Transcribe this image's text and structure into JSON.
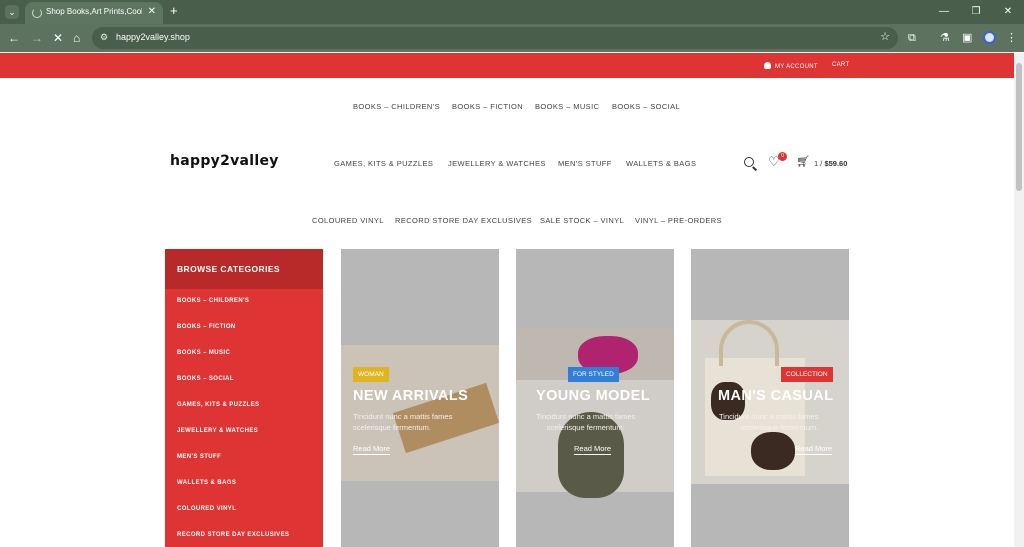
{
  "browser": {
    "tab_title": "Shop Books,Art Prints,Cool Gift",
    "url": "happy2valley.shop",
    "new_tab_label": "+"
  },
  "topbar": {
    "my_account": "MY ACCOUNT",
    "cart": "CART"
  },
  "top_menu": [
    "BOOKS – CHILDREN'S",
    "BOOKS – FICTION",
    "BOOKS – MUSIC",
    "BOOKS – SOCIAL"
  ],
  "logo": "happy2valley",
  "main_menu": [
    "GAMES, KITS & PUZZLES",
    "JEWELLERY & WATCHES",
    "MEN'S STUFF",
    "WALLETS & BAGS"
  ],
  "header_icons": {
    "wishlist_count": "0",
    "cart_count": "1 /",
    "cart_amount": "$59.60"
  },
  "bottom_menu": [
    "COLOURED VINYL",
    "RECORD STORE DAY EXCLUSIVES",
    "SALE STOCK – VINYL",
    "VINYL – PRE-ORDERS"
  ],
  "sidebar": {
    "title": "BROWSE CATEGORIES",
    "items": [
      "BOOKS – CHILDREN'S",
      "BOOKS – FICTION",
      "BOOKS – MUSIC",
      "BOOKS – SOCIAL",
      "GAMES, KITS & PUZZLES",
      "JEWELLERY & WATCHES",
      "MEN'S STUFF",
      "WALLETS & BAGS",
      "COLOURED VINYL",
      "RECORD STORE DAY EXCLUSIVES"
    ]
  },
  "banners": [
    {
      "chip": "WOMAN",
      "chip_color": "#e0b420",
      "title": "NEW ARRIVALS",
      "desc_1": "Tincidunt nunc a mattis fames",
      "desc_2": "scelerisque fermentum.",
      "link": "Read More"
    },
    {
      "chip": "FOR STYLED",
      "chip_color": "#2f7fd6",
      "title": "YOUNG MODEL",
      "desc_1": "Tincidunt nunc a mattis fames",
      "desc_2": "scelerisque fermentum.",
      "link": "Read More"
    },
    {
      "chip": "COLLECTION",
      "chip_color": "#df3434",
      "title": "MAN'S CASUAL",
      "desc_1": "Tincidunt nunc a mattis fames",
      "desc_2": "scelerisque fermentum.",
      "link": "Read More"
    }
  ],
  "colors": {
    "brand_red": "#df3434",
    "sidebar_head": "#b82a2a",
    "chrome_green": "#5d735f"
  }
}
